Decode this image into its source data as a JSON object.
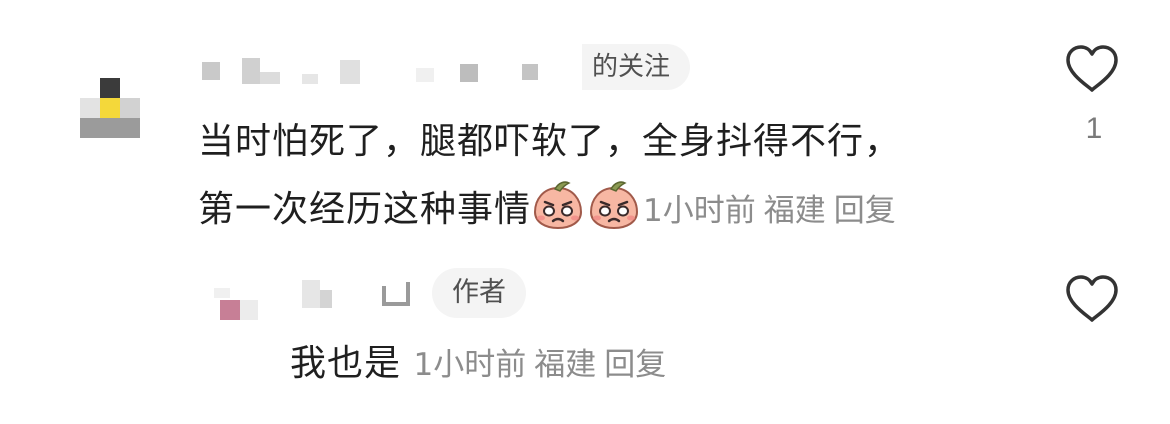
{
  "comment": {
    "tag": "的关注",
    "text_line1": "当时怕死了，腿都吓软了，全身抖得不行，",
    "text_line2": "第一次经历这种事情",
    "emojis": [
      "crying-peach-emoji",
      "crying-peach-emoji"
    ],
    "time": "1小时前",
    "location": "福建",
    "reply_label": "回复",
    "like_count": "1"
  },
  "reply": {
    "tag": "作者",
    "text": "我也是",
    "time": "1小时前",
    "location": "福建",
    "reply_label": "回复"
  },
  "colors": {
    "text": "#1f1f1f",
    "meta": "#8c8c8c",
    "tag_bg": "#f4f4f4",
    "avatar_yellow": "#f4d83a",
    "avatar_pink": "#c77f96"
  }
}
